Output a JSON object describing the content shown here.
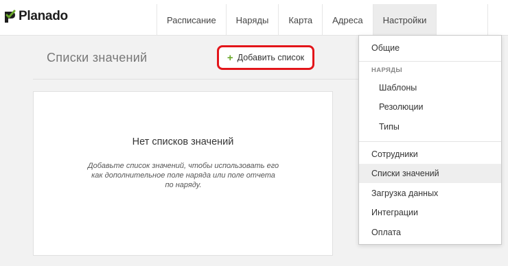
{
  "brand": {
    "name": "Planado",
    "accent": "#6aa82a"
  },
  "nav": {
    "items": [
      {
        "label": "Расписание",
        "active": false
      },
      {
        "label": "Наряды",
        "active": false
      },
      {
        "label": "Карта",
        "active": false
      },
      {
        "label": "Адреса",
        "active": false
      },
      {
        "label": "Настройки",
        "active": true
      }
    ]
  },
  "page": {
    "title": "Списки значений",
    "add_button": {
      "icon": "plus-icon",
      "label": "Добавить список",
      "highlight_color": "#e3151a"
    }
  },
  "empty_state": {
    "title": "Нет списков значений",
    "description": "Добавьте список значений, чтобы использовать его как дополнительное поле наряда или поле отчета по наряду."
  },
  "settings_menu": {
    "general": "Общие",
    "orders_header": "НАРЯДЫ",
    "orders_items": [
      "Шаблоны",
      "Резолюции",
      "Типы"
    ],
    "other_items": [
      {
        "label": "Сотрудники",
        "selected": false
      },
      {
        "label": "Списки значений",
        "selected": true
      },
      {
        "label": "Загрузка данных",
        "selected": false
      },
      {
        "label": "Интеграции",
        "selected": false
      },
      {
        "label": "Оплата",
        "selected": false
      }
    ]
  }
}
